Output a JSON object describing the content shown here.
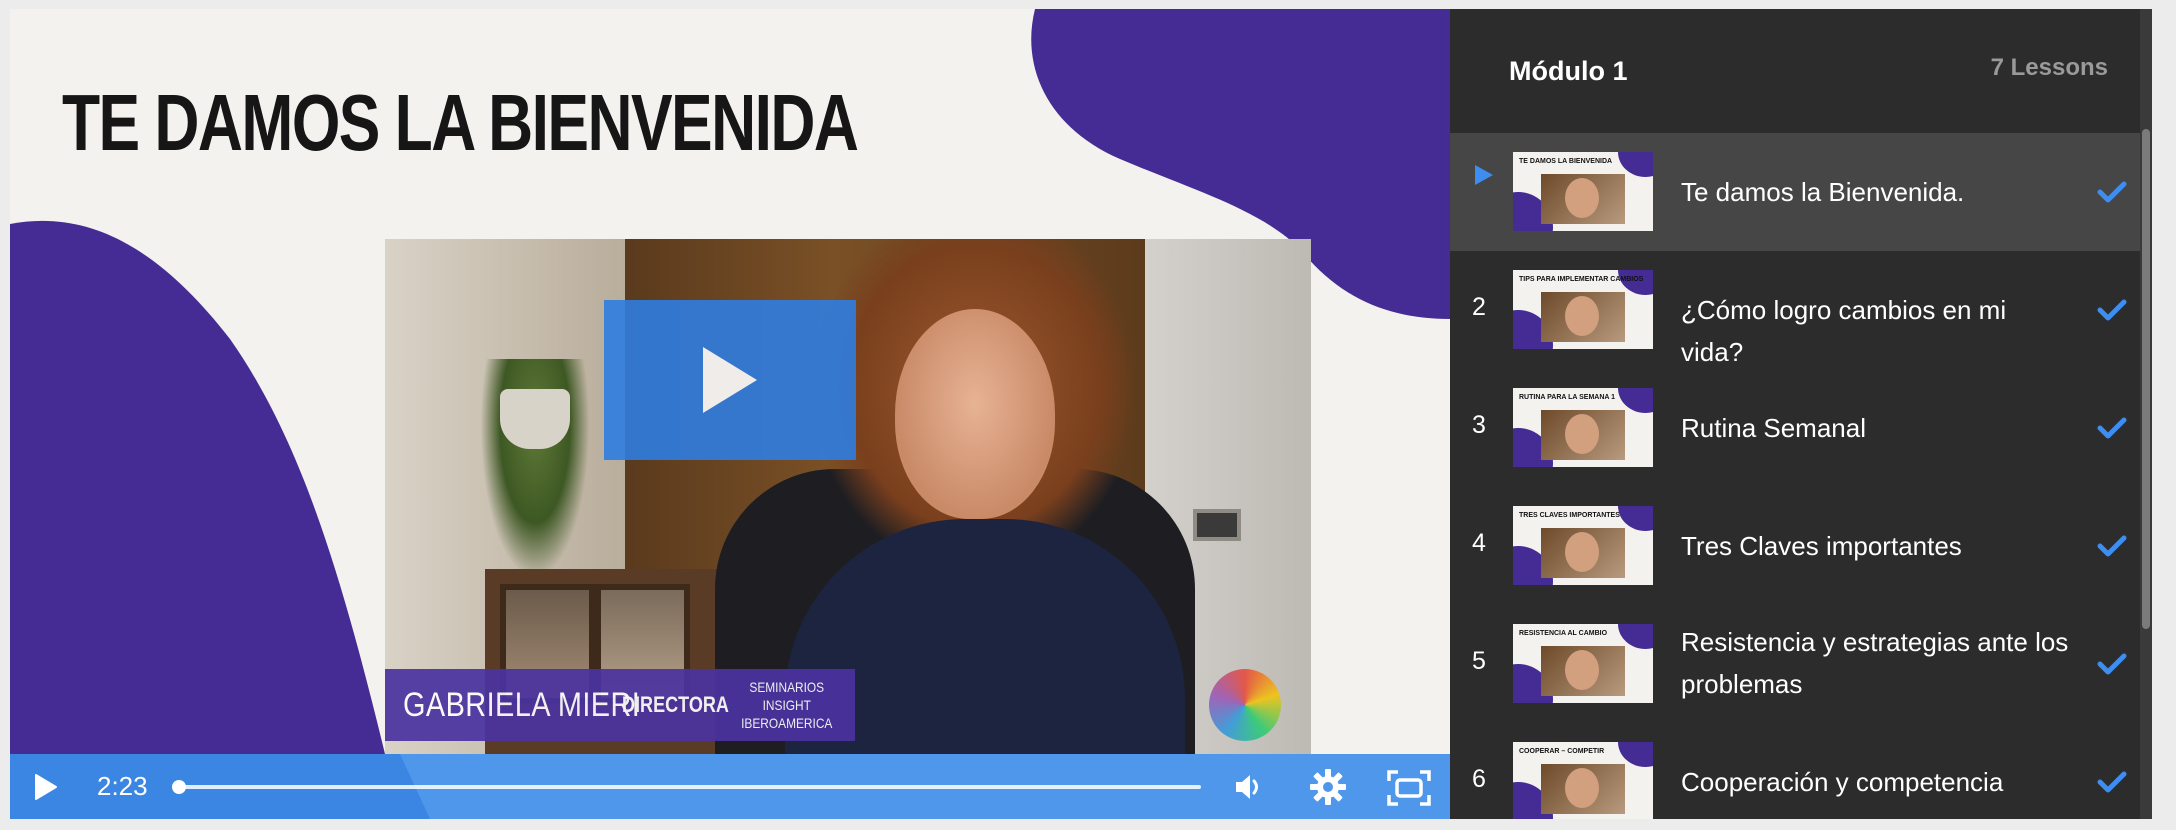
{
  "slide": {
    "title": "TE DAMOS LA BIENVENIDA"
  },
  "lower_third": {
    "name": "GABRIELA MIERI",
    "role": "DIRECTORA",
    "org": "SEMINARIOS INSIGHT\nIBEROAMERICA"
  },
  "player": {
    "time": "2:23",
    "progress_fraction": 0.0,
    "icons": [
      "play-icon",
      "volume-icon",
      "settings-gear-icon",
      "fullscreen-icon"
    ]
  },
  "module": {
    "title": "Módulo 1",
    "lesson_count": "7 Lessons",
    "lessons": [
      {
        "num": "",
        "title": "Te damos la Bienvenida.",
        "thumb_title": "TE DAMOS LA BIENVENIDA",
        "completed": true,
        "active": true
      },
      {
        "num": "2",
        "title": "¿Cómo logro cambios en mi vida?",
        "thumb_title": "TIPS PARA IMPLEMENTAR CAMBIOS",
        "completed": true,
        "active": false
      },
      {
        "num": "3",
        "title": "Rutina Semanal",
        "thumb_title": "RUTINA PARA LA SEMANA 1",
        "completed": true,
        "active": false
      },
      {
        "num": "4",
        "title": "Tres Claves importantes",
        "thumb_title": "TRES CLAVES IMPORTANTES",
        "completed": true,
        "active": false
      },
      {
        "num": "5",
        "title": "Resistencia y estrategias ante los problemas",
        "thumb_title": "RESISTENCIA AL CAMBIO",
        "completed": true,
        "active": false
      },
      {
        "num": "6",
        "title": "Cooperación y competencia",
        "thumb_title": "COOPERAR – COMPETIR",
        "completed": true,
        "active": false
      }
    ]
  },
  "colors": {
    "accent_purple": "#452c94",
    "player_blue": "#4e97ea",
    "check_blue": "#3d8ef0",
    "sidebar_bg": "#2c2c2c",
    "active_row_bg": "#464646"
  }
}
